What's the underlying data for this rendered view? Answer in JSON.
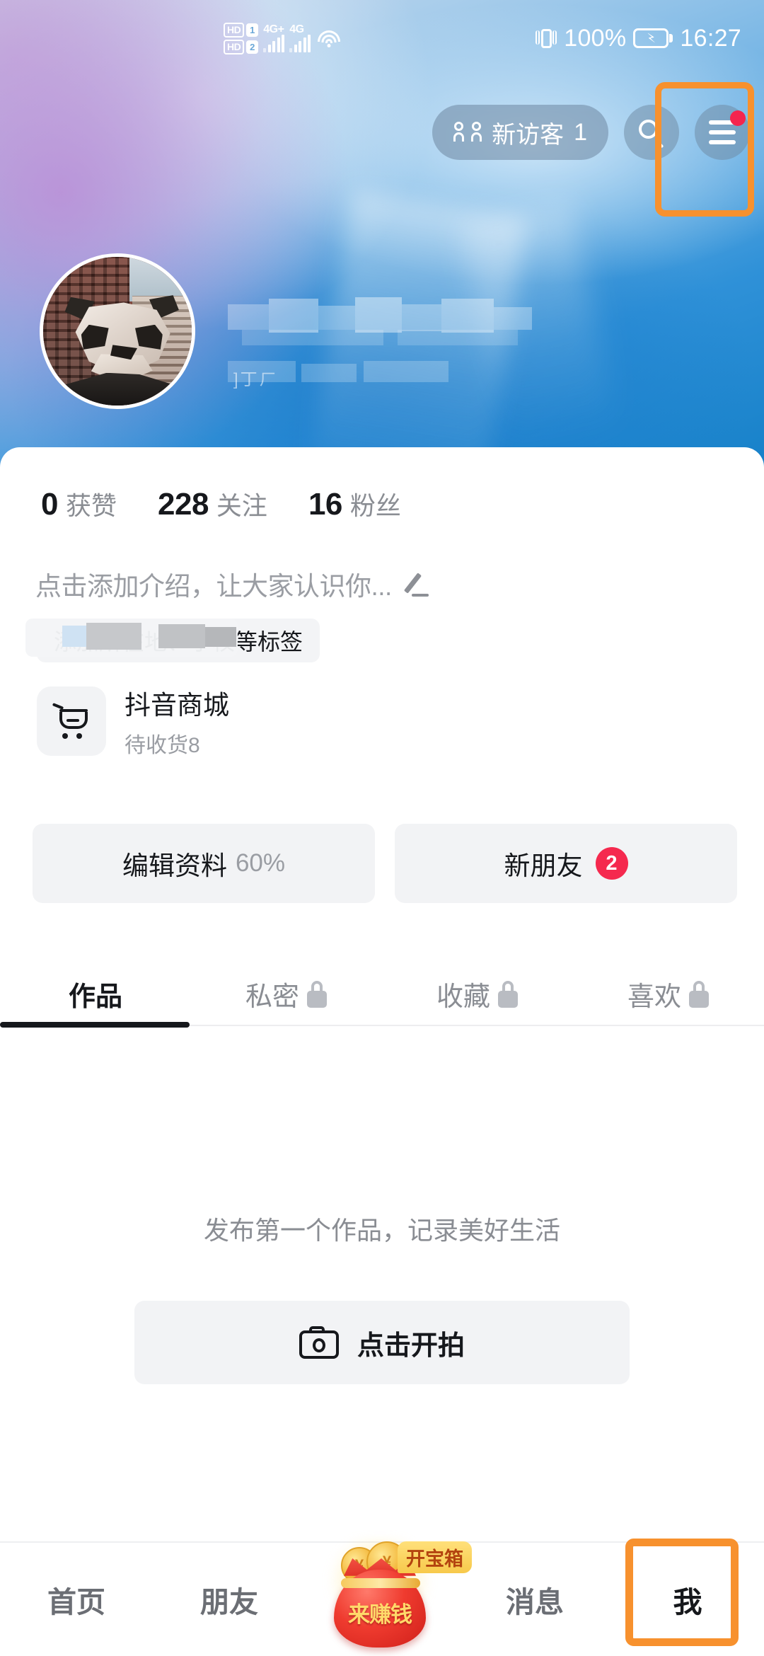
{
  "status_bar": {
    "hd1_label": "HD",
    "sim1": "1",
    "hd2_label": "HD",
    "sim2": "2",
    "net1": "4G+",
    "net2": "4G",
    "battery_percent": "100%",
    "time": "16:27",
    "icons": [
      "hd-icon",
      "sim-card-icon",
      "signal-bars-icon",
      "wifi-icon",
      "vibrate-icon",
      "battery-charging-icon"
    ]
  },
  "top_nav": {
    "visitor_label": "新访客",
    "visitor_count": "1",
    "search_icon": "search-icon",
    "menu_icon": "hamburger-menu-icon",
    "menu_has_badge": true,
    "highlight_color": "#f7912e"
  },
  "profile": {
    "avatar": "panda-sculpture-avatar",
    "username_redacted": true,
    "handle_ghost": "]丁ㄏ",
    "stats": [
      {
        "value": "0",
        "label": "获赞"
      },
      {
        "value": "228",
        "label": "关注"
      },
      {
        "value": "16",
        "label": "粉丝"
      }
    ],
    "bio_placeholder": "点击添加介绍，让大家认识你...",
    "bio_edit_icon": "pencil-icon",
    "tag_placeholder": "添加所在地、学校等标签"
  },
  "mall": {
    "icon": "shopping-cart-icon",
    "title": "抖音商城",
    "subtitle": "待收货8"
  },
  "actions": [
    {
      "label": "编辑资料",
      "sub": "60%",
      "badge": null
    },
    {
      "label": "新朋友",
      "sub": "",
      "badge": "2"
    }
  ],
  "tabs": [
    {
      "label": "作品",
      "locked": false,
      "active": true
    },
    {
      "label": "私密",
      "locked": true,
      "active": false
    },
    {
      "label": "收藏",
      "locked": true,
      "active": false
    },
    {
      "label": "喜欢",
      "locked": true,
      "active": false
    }
  ],
  "empty_state": {
    "message": "发布第一个作品，记录美好生活",
    "button_label": "点击开拍",
    "button_icon": "camera-icon"
  },
  "bottom_nav": {
    "items": [
      {
        "label": "首页",
        "active": false
      },
      {
        "label": "朋友",
        "active": false
      },
      {
        "label": "消息",
        "active": false
      },
      {
        "label": "我",
        "active": true
      }
    ],
    "money_bag": {
      "label": "来赚钱",
      "tooltip": "开宝箱",
      "icon": "money-bag-icon"
    },
    "highlight_color": "#f7912e"
  },
  "colors": {
    "banner_blue": "#1580c8",
    "accent_orange": "#f7912e",
    "badge_red": "#f5294e",
    "text_primary": "#16181c",
    "text_secondary": "#8a8d93",
    "surface_gray": "#f2f3f5"
  }
}
